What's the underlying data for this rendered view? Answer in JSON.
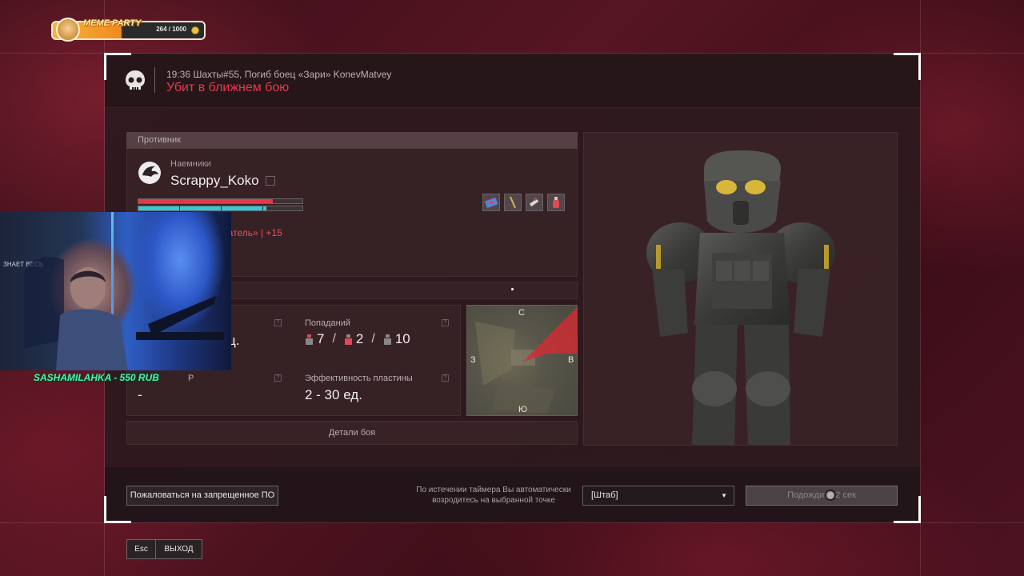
{
  "badge": {
    "title": "MEME PARTY",
    "count": "264 / 1000"
  },
  "header": {
    "event_line": "19:36 Шахты#55, Погиб боец «Зари» KonevMatvey",
    "kill_type": "Убит в ближнем бою"
  },
  "enemy": {
    "section_title": "Противник",
    "faction": "Наемники",
    "name": "Scrappy_Koko",
    "health": 0.82,
    "armor": 0.78,
    "bounty_text": "ратель» | +15",
    "equipment": [
      "medkit-icon",
      "knife-icon",
      "syringe-icon",
      "bottle-icon"
    ]
  },
  "stats": {
    "hits_label": "Попаданий",
    "hits": [
      {
        "value": "7",
        "zone": "head"
      },
      {
        "value": "2",
        "zone": "torso"
      },
      {
        "value": "10",
        "zone": "legs"
      }
    ],
    "left_top_value": "ц.",
    "left_bottom_label": "Р",
    "left_bottom_value": "-",
    "plate_label": "Эффективность пластины",
    "plate_value": "2 - 30 ед."
  },
  "minimap": {
    "north": "С",
    "south": "Ю",
    "west": "З",
    "east": "В"
  },
  "details_button": "Детали боя",
  "footer": {
    "report_button": "Пожаловаться на запрещенное ПО",
    "respawn_note": "По истечении таймера Вы автоматически возродитесь на выбранной точке",
    "spawn_point": "[Штаб]",
    "wait_button": "Подождите 2 сек"
  },
  "esc": {
    "key": "Esc",
    "label": "ВЫХОД"
  },
  "stream": {
    "donation": "SASHAMILAHKA - 550 RUB",
    "wall_text": "ЗНАЕТ ВЕСЬ"
  },
  "colors": {
    "accent_red": "#e23c4b",
    "health": "#e03a48",
    "armor": "#35c8d4",
    "donation": "#4df2a8"
  }
}
